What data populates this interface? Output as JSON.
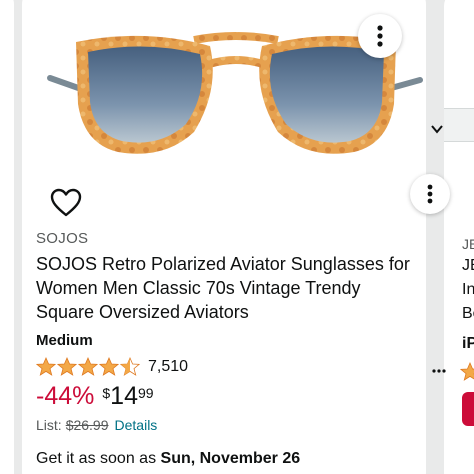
{
  "product": {
    "brand": "SOJOS",
    "title": "SOJOS Retro Polarized Aviator Sunglasses for Women Men Classic 70s Vintage Trendy Square Oversized Aviators",
    "size": "Medium",
    "rating": 4.5,
    "rating_count": "7,510",
    "discount": "-44%",
    "price_symbol": "$",
    "price_whole": "14",
    "price_fraction": "99",
    "list_label": "List:",
    "list_price": "$26.99",
    "details_label": "Details",
    "delivery_prefix": "Get it as soon as ",
    "delivery_date": "Sun, November 26"
  },
  "next_card": {
    "brand_fragment": "JE",
    "title_line1": "JE",
    "title_line2": "In",
    "title_line3": "Be",
    "size_fragment": "iP"
  },
  "icons": {
    "more": "more-vertical-icon",
    "wishlist": "heart-outline-icon",
    "star": "star-icon"
  },
  "colors": {
    "star": "#f3a847",
    "discount": "#cc0c39",
    "link": "#007185",
    "muted": "#565959",
    "frame": "#d9923f",
    "lens": "#5a7595"
  }
}
